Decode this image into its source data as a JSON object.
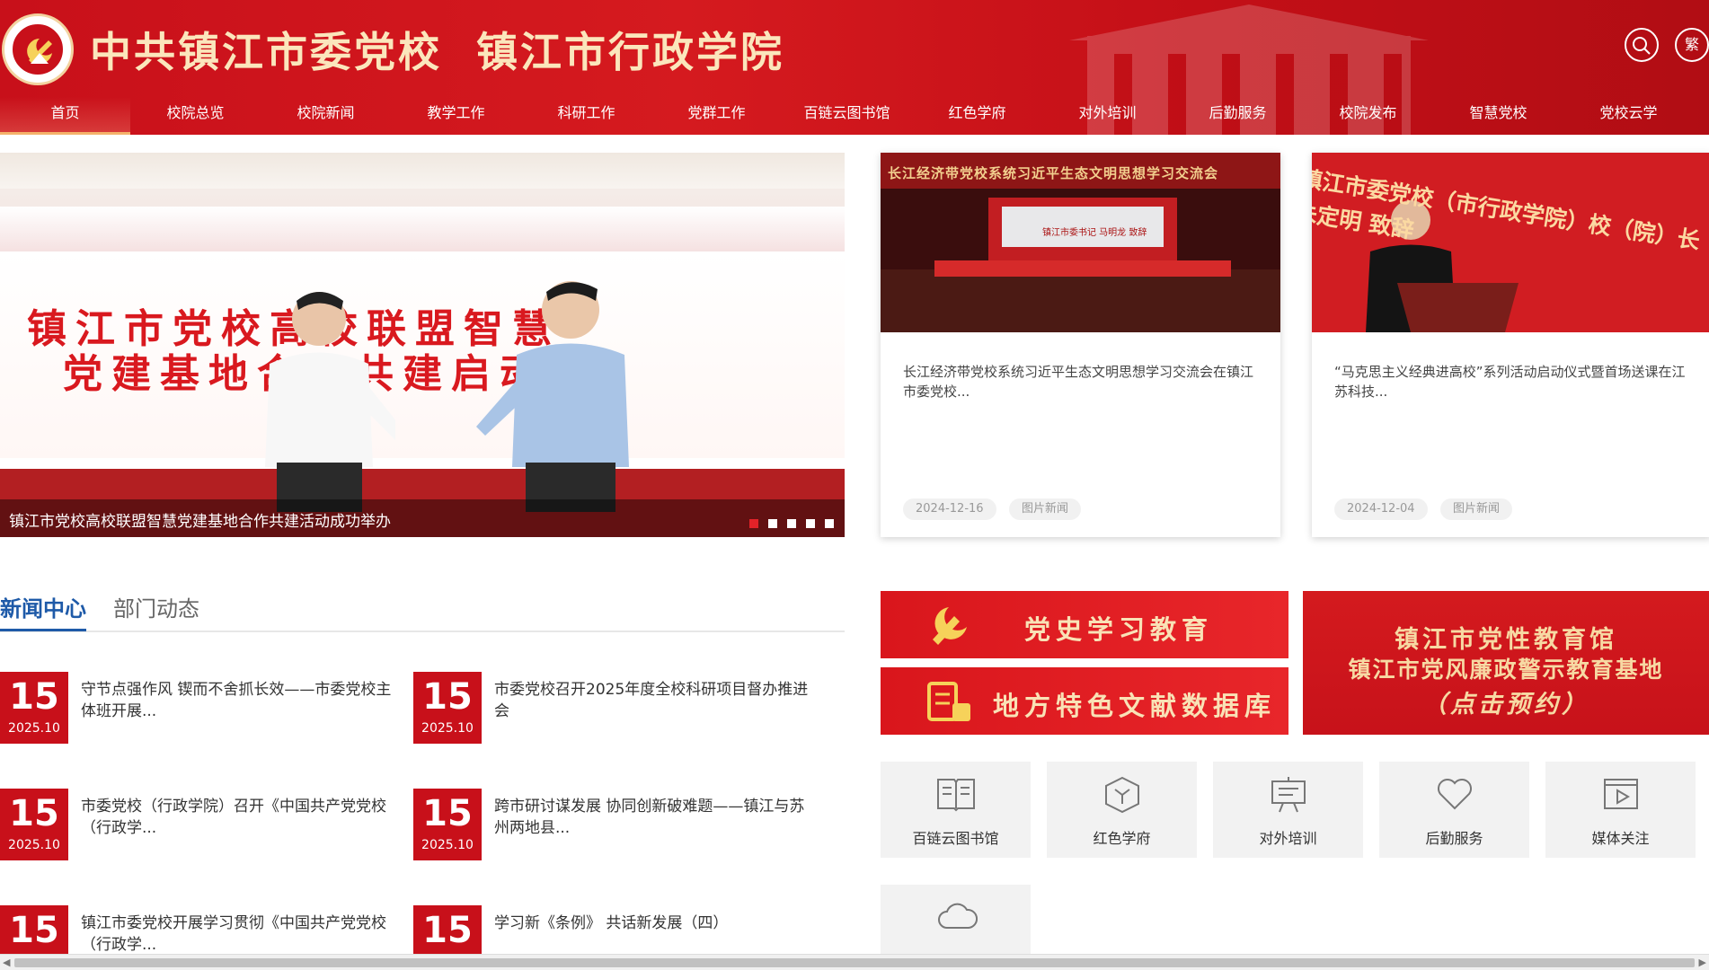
{
  "header": {
    "title_part1": "中共镇江市委党校",
    "title_part2": "镇江市行政学院",
    "search_icon": "search-icon",
    "traditional_label": "繁"
  },
  "nav": {
    "items": [
      {
        "label": "首页"
      },
      {
        "label": "校院总览"
      },
      {
        "label": "校院新闻"
      },
      {
        "label": "教学工作"
      },
      {
        "label": "科研工作"
      },
      {
        "label": "党群工作"
      },
      {
        "label": "百链云图书馆"
      },
      {
        "label": "红色学府"
      },
      {
        "label": "对外培训"
      },
      {
        "label": "后勤服务"
      },
      {
        "label": "校院发布"
      },
      {
        "label": "智慧党校"
      },
      {
        "label": "党校云学"
      }
    ],
    "active_index": 0
  },
  "slider": {
    "banner_line1": "镇江市党校高校联盟智慧",
    "banner_line2": "党建基地合作共建启动",
    "caption": "镇江市党校高校联盟智慧党建基地合作共建活动成功举办",
    "slide_count": 5,
    "active_slide": 0
  },
  "cards": [
    {
      "image_banner": "长江经济带党校系统习近平生态文明思想学习交流会",
      "image_screen_title": "镇江市委书记 马明龙 致辞",
      "title": "长江经济带党校系统习近平生态文明思想学习交流会在镇江市委党校...",
      "date": "2024-12-16",
      "category": "图片新闻"
    },
    {
      "image_banner": "镇江市委党校（市行政学院）校（院）长朱定明 致辞",
      "title": "“马克思主义经典进高校”系列活动启动仪式暨首场送课在江苏科技...",
      "date": "2024-12-04",
      "category": "图片新闻"
    }
  ],
  "news_tabs": {
    "tab1": "新闻中心",
    "tab2": "部门动态"
  },
  "news": [
    {
      "day": "15",
      "ym": "2025.10",
      "title": "守节点强作风 锲而不舍抓长效——市委党校主体班开展..."
    },
    {
      "day": "15",
      "ym": "2025.10",
      "title": "市委党校召开2025年度全校科研项目督办推进会"
    },
    {
      "day": "15",
      "ym": "2025.10",
      "title": "市委党校（行政学院）召开《中国共产党党校（行政学..."
    },
    {
      "day": "15",
      "ym": "2025.10",
      "title": "跨市研讨谋发展 协同创新破难题——镇江与苏州两地县..."
    },
    {
      "day": "15",
      "ym": "",
      "title": "镇江市委党校开展学习贯彻《中国共产党党校（行政学..."
    },
    {
      "day": "15",
      "ym": "",
      "title": "学习新《条例》 共话新发展（四）"
    }
  ],
  "promos": {
    "party_history": "党史学习教育",
    "local_docs": "地方特色文献数据库",
    "edu_hall_line1": "镇江市党性教育馆",
    "edu_hall_line2": "镇江市党风廉政警示教育基地",
    "edu_hall_line3": "（点击预约）"
  },
  "tiles": [
    {
      "label": "百链云图书馆",
      "icon": "book-icon"
    },
    {
      "label": "红色学府",
      "icon": "cube-icon"
    },
    {
      "label": "对外培训",
      "icon": "chat-board-icon"
    },
    {
      "label": "后勤服务",
      "icon": "heart-icon"
    },
    {
      "label": "媒体关注",
      "icon": "play-icon"
    },
    {
      "label": "",
      "icon": "cloud-icon"
    }
  ],
  "colors": {
    "brand_red": "#c8101a",
    "gold": "#fbe6bc",
    "tab_blue": "#1e5aa8"
  }
}
